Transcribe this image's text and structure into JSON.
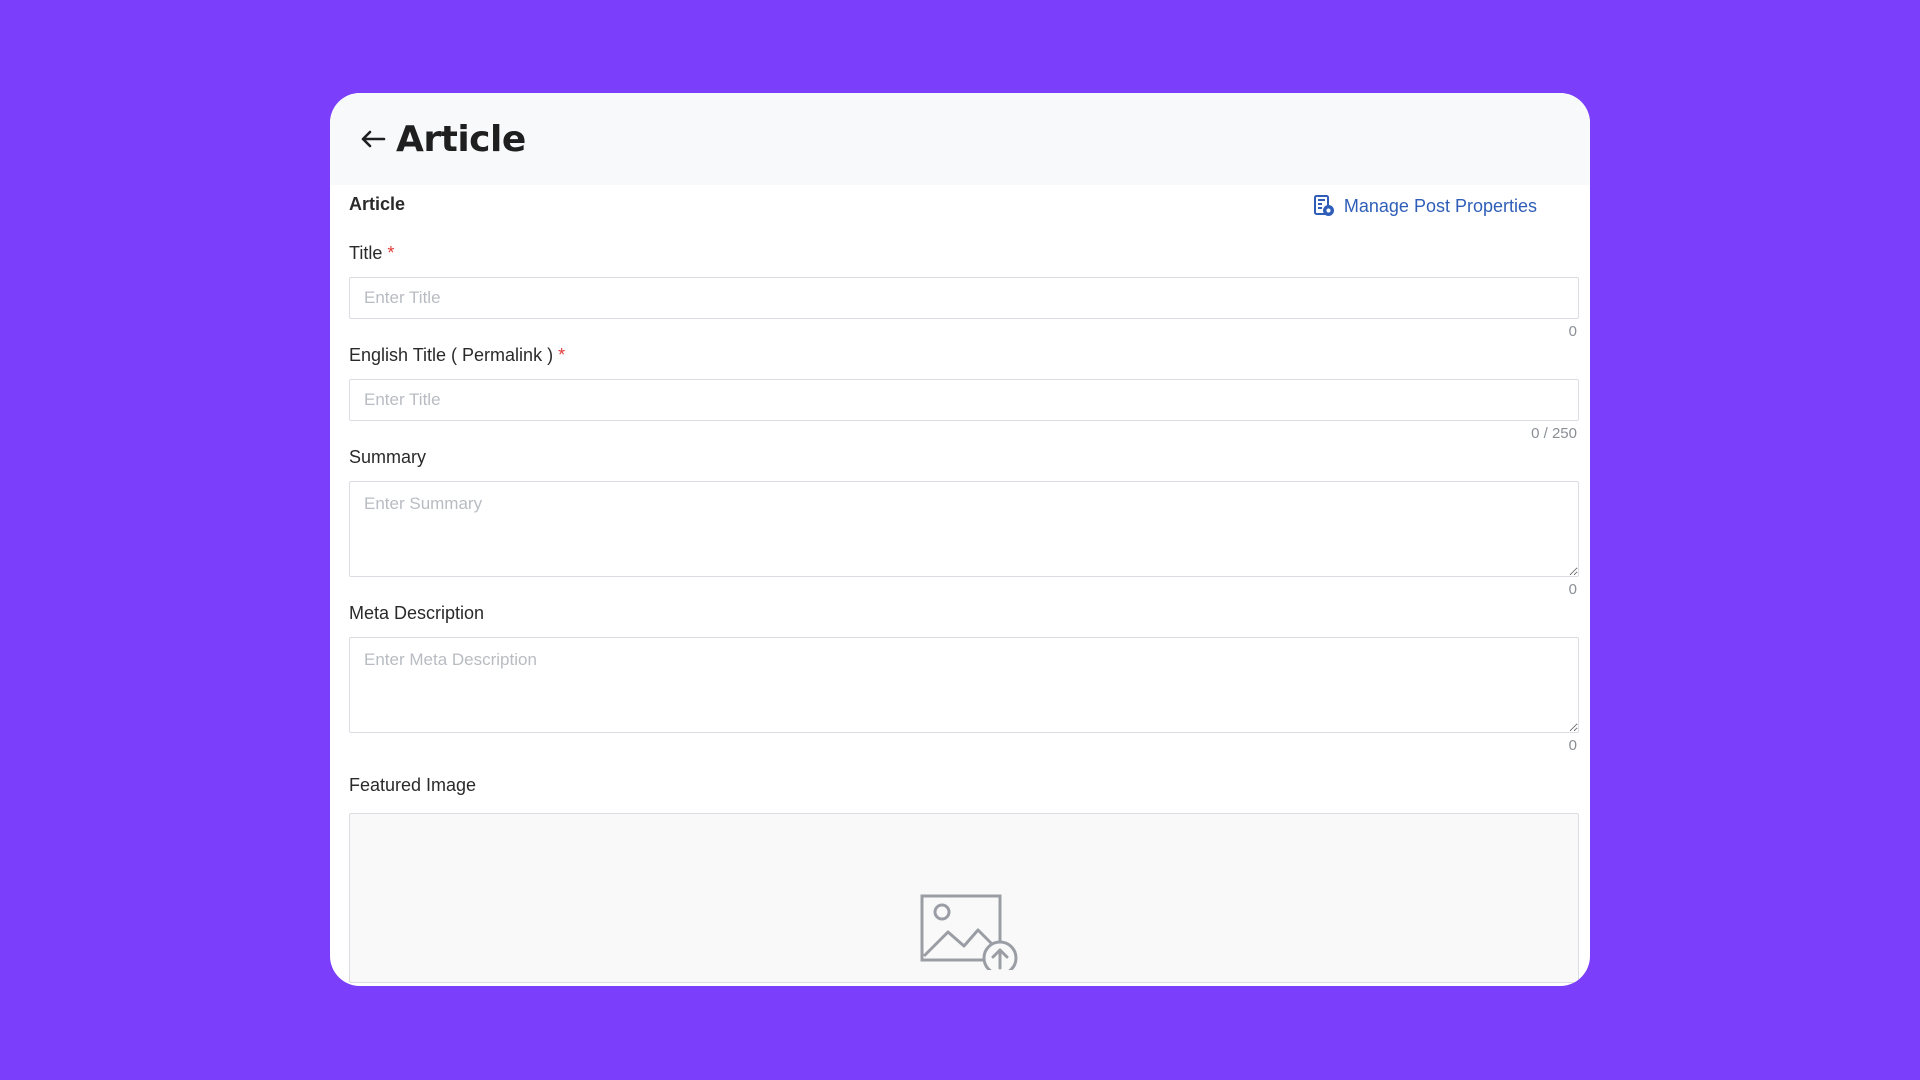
{
  "header": {
    "back_icon": "arrow-left-icon",
    "title": "Article"
  },
  "section": {
    "label": "Article",
    "manage_link": "Manage Post Properties",
    "manage_icon": "document-settings-icon"
  },
  "fields": {
    "title": {
      "label": "Title",
      "required": "*",
      "placeholder": "Enter Title",
      "value": "",
      "counter": "0"
    },
    "english_title": {
      "label": "English Title ( Permalink )",
      "required": "*",
      "placeholder": "Enter Title",
      "value": "",
      "counter": "0 / 250"
    },
    "summary": {
      "label": "Summary",
      "placeholder": "Enter Summary",
      "value": "",
      "counter": "0"
    },
    "meta_description": {
      "label": "Meta Description",
      "placeholder": "Enter Meta Description",
      "value": "",
      "counter": "0"
    },
    "featured_image": {
      "label": "Featured Image",
      "icon": "image-upload-icon"
    }
  },
  "colors": {
    "background": "#7b3ffc",
    "link": "#2f5eb8",
    "required": "#e03a3a"
  }
}
